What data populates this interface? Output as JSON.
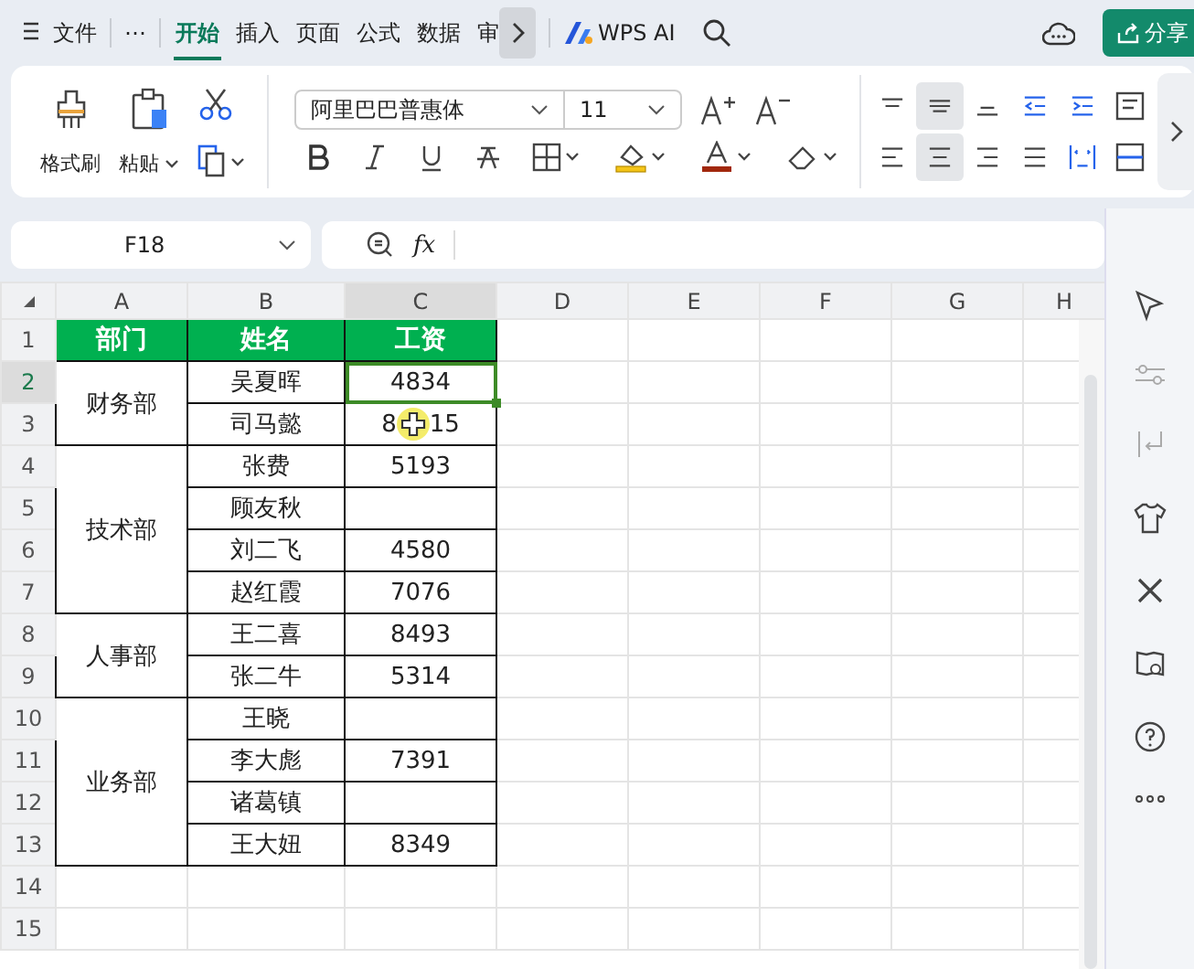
{
  "top_bar": {
    "menu_label": "文件",
    "more": "⋯",
    "tabs": [
      {
        "label": "开始",
        "selected": true
      },
      {
        "label": "插入",
        "selected": false
      },
      {
        "label": "页面",
        "selected": false
      },
      {
        "label": "公式",
        "selected": false
      },
      {
        "label": "数据",
        "selected": false
      },
      {
        "label": "审",
        "selected": false
      }
    ],
    "ai_label": "WPS AI",
    "share_label": "分享"
  },
  "ribbon": {
    "format_painter": "格式刷",
    "paste": "粘贴",
    "font_name": "阿里巴巴普惠体",
    "font_size": "11"
  },
  "formula_bar": {
    "name_box": "F18",
    "fx": "fx"
  },
  "sheet": {
    "columns": [
      {
        "label": "A",
        "selected": false
      },
      {
        "label": "B",
        "selected": false
      },
      {
        "label": "C",
        "selected": true
      },
      {
        "label": "D",
        "selected": false
      },
      {
        "label": "E",
        "selected": false
      },
      {
        "label": "F",
        "selected": false
      },
      {
        "label": "G",
        "selected": false
      },
      {
        "label": "H",
        "selected": false
      }
    ],
    "header_row": "1",
    "headers": [
      "部门",
      "姓名",
      "工资"
    ],
    "groups": [
      {
        "dept": "财务部",
        "members": [
          {
            "row": "2",
            "name": "吴夏晖",
            "salary": "4834",
            "selected": true
          },
          {
            "row": "3",
            "name": "司马懿",
            "salary_parts": [
              "8",
              "15"
            ],
            "selected": false
          }
        ]
      },
      {
        "dept": "技术部",
        "members": [
          {
            "row": "4",
            "name": "张费",
            "salary": "5193",
            "selected": false
          },
          {
            "row": "5",
            "name": "顾友秋",
            "selected": false
          },
          {
            "row": "6",
            "name": "刘二飞",
            "salary": "4580",
            "selected": false
          },
          {
            "row": "7",
            "name": "赵红霞",
            "salary": "7076",
            "selected": false
          }
        ]
      },
      {
        "dept": "人事部",
        "members": [
          {
            "row": "8",
            "name": "王二喜",
            "salary": "8493",
            "selected": false
          },
          {
            "row": "9",
            "name": "张二牛",
            "salary": "5314",
            "selected": false
          }
        ]
      },
      {
        "dept": "业务部",
        "members": [
          {
            "row": "10",
            "name": "王晓",
            "selected": false
          },
          {
            "row": "11",
            "name": "李大彪",
            "salary": "7391",
            "selected": false
          },
          {
            "row": "12",
            "name": "诸葛镇",
            "selected": false
          },
          {
            "row": "13",
            "name": "王大妞",
            "salary": "8349",
            "selected": false
          }
        ]
      }
    ],
    "empty_rows": [
      "14",
      "15"
    ]
  }
}
